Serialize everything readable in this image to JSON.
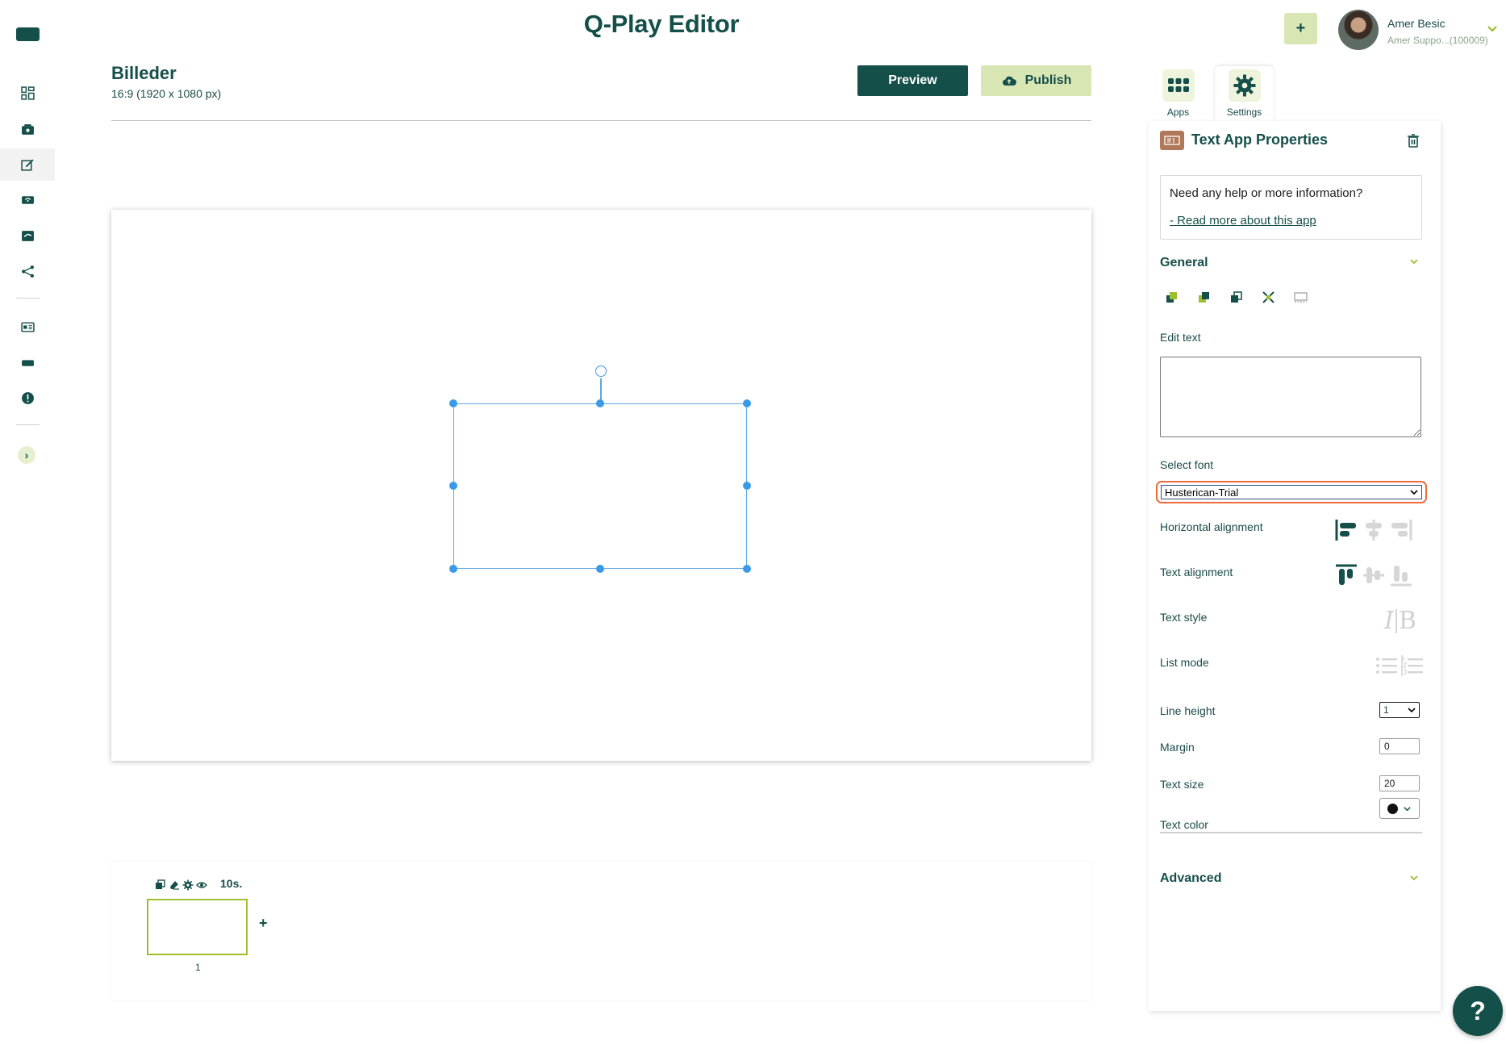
{
  "app": {
    "title": "Q-Play Editor"
  },
  "user": {
    "name": "Amer Besic",
    "subtitle": "Amer Suppo...(100009)"
  },
  "header": {
    "add_label": "+"
  },
  "document": {
    "title": "Billeder",
    "resolution": "16:9 (1920 x 1080 px)"
  },
  "toolbar": {
    "preview_label": "Preview",
    "publish_label": "Publish"
  },
  "sidebar": {
    "icons": [
      "dashboard-icon",
      "media-icon",
      "editor-icon",
      "screens-icon",
      "playlist-icon",
      "share-icon",
      "templates-icon",
      "devices-icon",
      "info-icon",
      "expand-icon"
    ],
    "active": "editor-icon"
  },
  "timeline": {
    "slides": [
      {
        "number": "1",
        "duration": "10s."
      }
    ],
    "add_label": "+"
  },
  "panel": {
    "tabs": [
      {
        "label": "Apps"
      },
      {
        "label": "Settings"
      }
    ],
    "active_tab": "Settings",
    "title": "Text App Properties",
    "help_question": "Need any help or more information?",
    "help_link": "- Read more about this app",
    "general_label": "General",
    "advanced_label": "Advanced",
    "fields": {
      "edit_text_label": "Edit text",
      "edit_text_value": "",
      "select_font_label": "Select font",
      "select_font_value": "Husterican-Trial",
      "horizontal_alignment_label": "Horizontal alignment",
      "text_alignment_label": "Text alignment",
      "text_style_label": "Text style",
      "text_style_italic": "I",
      "text_style_bold": "B",
      "list_mode_label": "List mode",
      "line_height_label": "Line height",
      "line_height_value": "1",
      "margin_label": "Margin",
      "margin_value": "0",
      "text_size_label": "Text size",
      "text_size_value": "20",
      "text_color_label": "Text color",
      "text_color_value": "#111111"
    }
  },
  "help_fab": {
    "label": "?"
  },
  "colors": {
    "brand": "#154f4a",
    "accent": "#d8e6b4",
    "selection": "#3b9ae8",
    "focus_ring": "#f06a3a"
  }
}
